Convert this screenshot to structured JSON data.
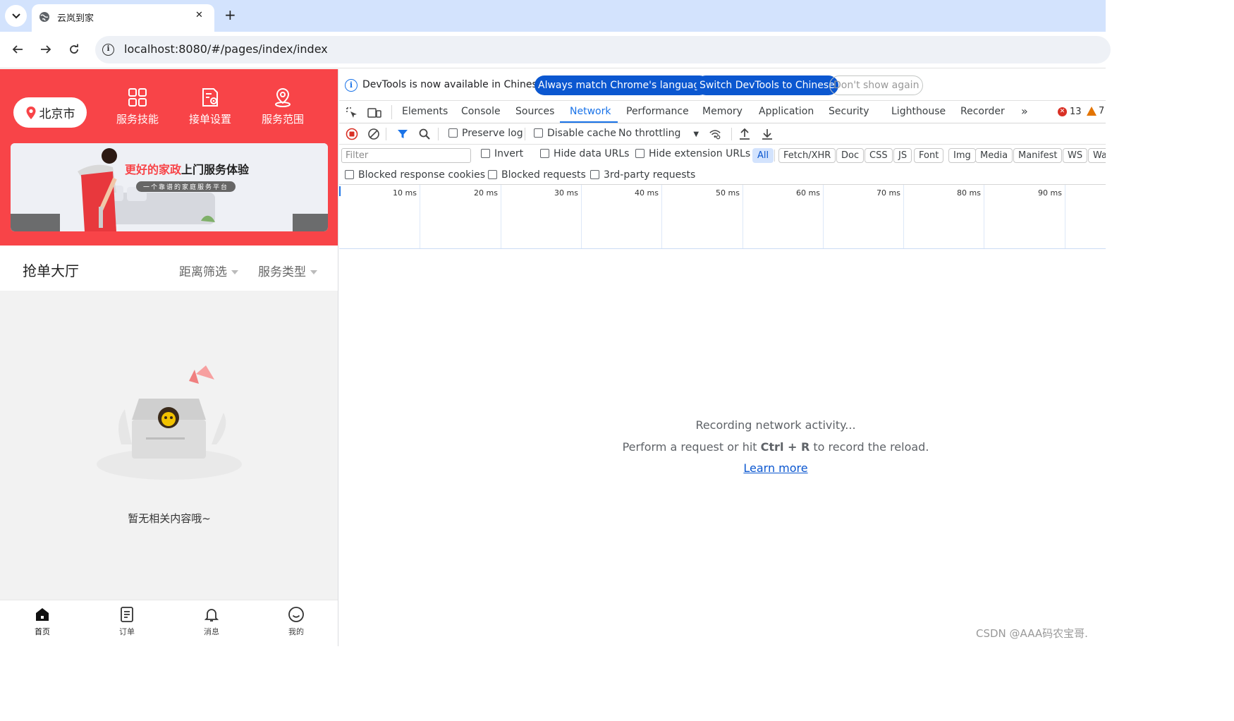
{
  "browser": {
    "tab_title": "云岚到家",
    "url": "localhost:8080/#/pages/index/index"
  },
  "app": {
    "city": "北京市",
    "quick_nav": [
      {
        "label": "服务技能",
        "icon": "grid-icon"
      },
      {
        "label": "接单设置",
        "icon": "order-settings-icon"
      },
      {
        "label": "服务范围",
        "icon": "location-range-icon"
      }
    ],
    "banner": {
      "title_highlight": "更好的家政",
      "title_rest": "上门服务体验",
      "subtitle": "一个靠谱的家庭服务平台"
    },
    "hall": {
      "title": "抢单大厅",
      "filter_distance": "距离筛选",
      "filter_type": "服务类型"
    },
    "empty_text": "暂无相关内容哦~",
    "tabbar": [
      {
        "label": "首页",
        "icon": "home-icon"
      },
      {
        "label": "订单",
        "icon": "order-list-icon"
      },
      {
        "label": "消息",
        "icon": "bell-icon"
      },
      {
        "label": "我的",
        "icon": "profile-icon"
      }
    ],
    "colors": {
      "primary": "#f84448"
    }
  },
  "devtools": {
    "info_message": "DevTools is now available in Chinese!",
    "btn_match_language": "Always match Chrome's language",
    "btn_switch_chinese": "Switch DevTools to Chinese",
    "btn_dont_show": "Don't show again",
    "panel_tabs": [
      "Elements",
      "Console",
      "Sources",
      "Network",
      "Performance",
      "Memory",
      "Application",
      "Security",
      "Lighthouse",
      "Recorder"
    ],
    "active_tab": "Network",
    "error_count": "13",
    "warning_count": "7",
    "toolbar": {
      "preserve_log": "Preserve log",
      "disable_cache": "Disable cache",
      "throttling": "No throttling"
    },
    "filter": {
      "placeholder": "Filter",
      "invert": "Invert",
      "hide_data_urls": "Hide data URLs",
      "hide_extension_urls": "Hide extension URLs",
      "types": [
        "All",
        "Fetch/XHR",
        "Doc",
        "CSS",
        "JS",
        "Font",
        "Img",
        "Media",
        "Manifest",
        "WS",
        "Wa"
      ],
      "blocked_response_cookies": "Blocked response cookies",
      "blocked_requests": "Blocked requests",
      "third_party_requests": "3rd-party requests"
    },
    "timeline_ticks": [
      "10 ms",
      "20 ms",
      "30 ms",
      "40 ms",
      "50 ms",
      "60 ms",
      "70 ms",
      "80 ms",
      "90 ms"
    ],
    "empty": {
      "line1": "Recording network activity...",
      "line2_before": "Perform a request or hit ",
      "line2_keys": "Ctrl + R",
      "line2_after": " to record the reload.",
      "learn_more": "Learn more"
    }
  },
  "watermark": "CSDN @AAA码农宝哥."
}
